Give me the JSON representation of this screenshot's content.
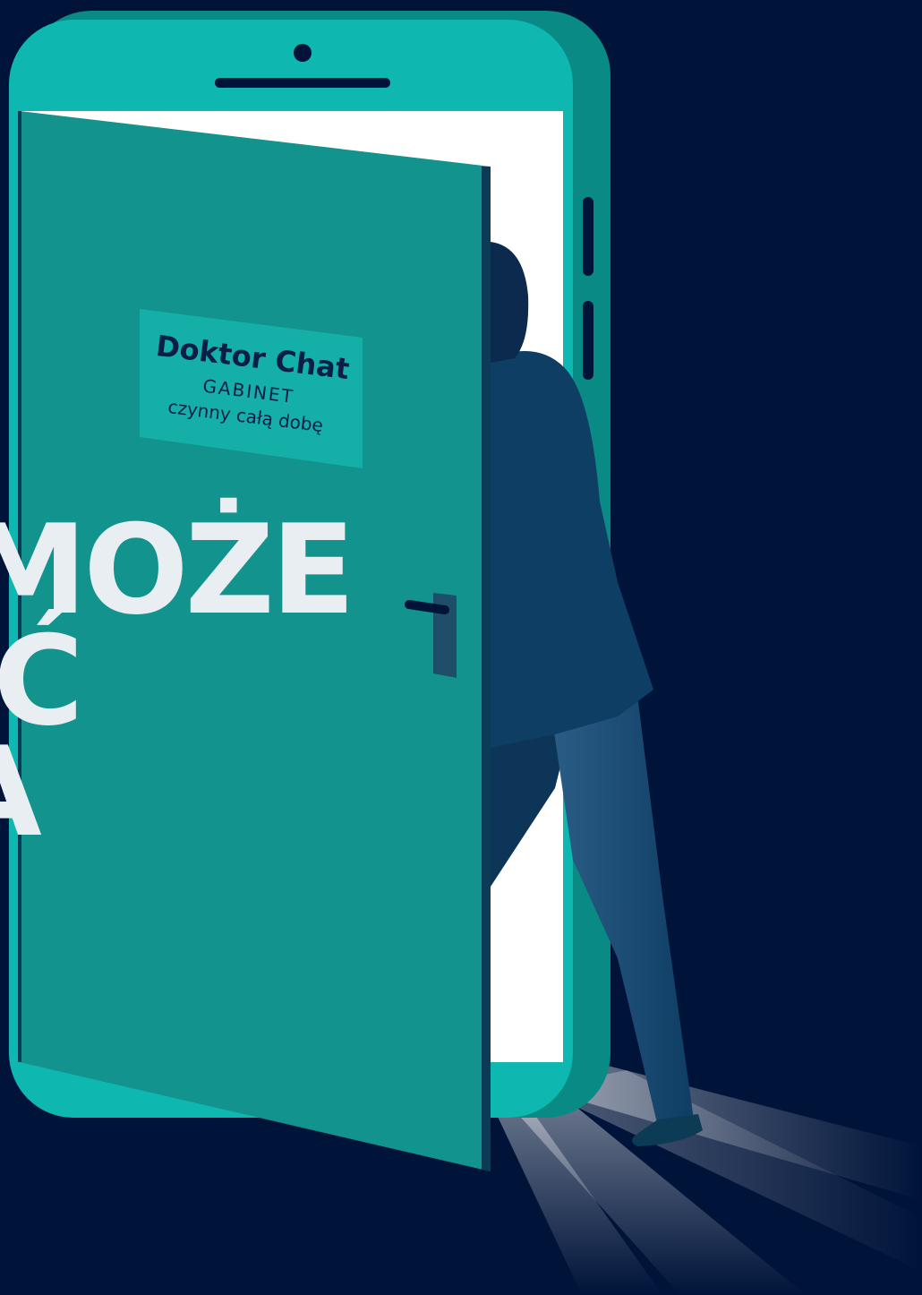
{
  "colors": {
    "background": "#00143a",
    "phone_body": "#0eb8b0",
    "phone_side": "#0a8a84",
    "door": "#12938d",
    "door_edge": "#0c3c55",
    "sign_plate": "#14b0a8",
    "light": "#ffffff",
    "person_jacket": "#0e3e63",
    "person_pants": "#1c4f78",
    "headline_text": "#e8eef2"
  },
  "headline": {
    "line1": "MOŻE",
    "line2": "IĆ",
    "line3": "A"
  },
  "door_sign": {
    "title": "Doktor Chat",
    "subtitle": "GABINET",
    "note": "czynny całą dobę"
  },
  "icons": {
    "camera": "front-camera-icon",
    "speaker": "speaker-grille-icon",
    "handle": "door-handle-icon"
  }
}
